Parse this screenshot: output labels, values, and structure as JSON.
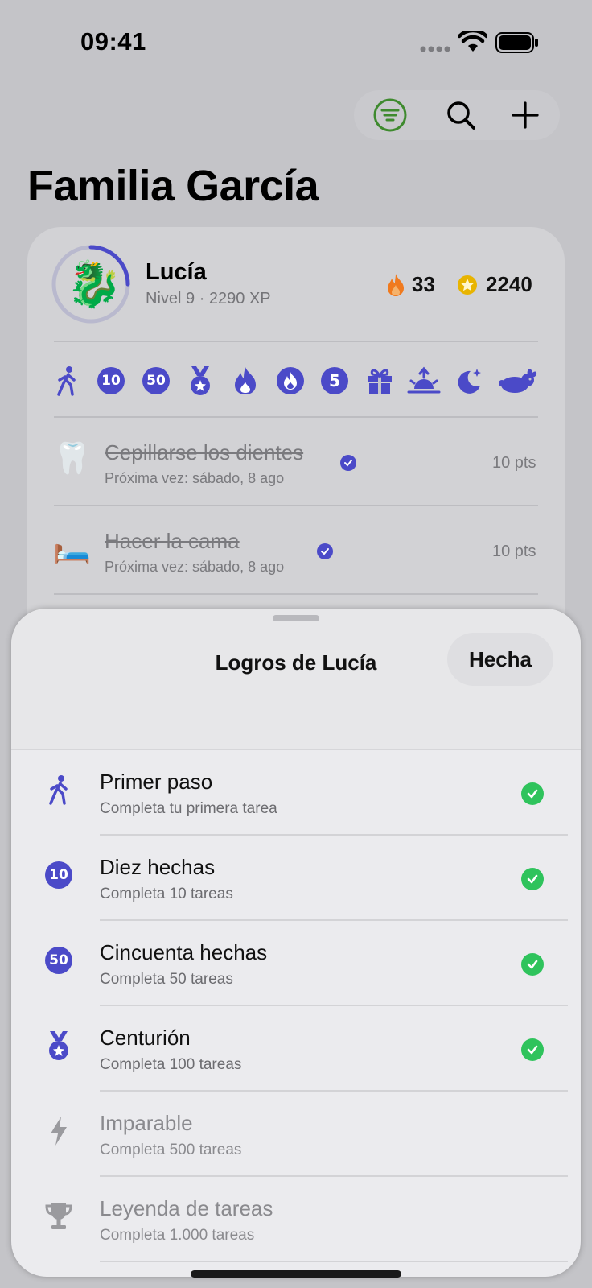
{
  "status_bar": {
    "time": "09:41"
  },
  "title": "Familia García",
  "member": {
    "name": "Lucía",
    "subtitle": "Nivel 9 · 2290 XP",
    "avatar": "🐉",
    "streak": "33",
    "coins": "2240",
    "level_progress": 0.25
  },
  "badges": [
    "walk",
    "10",
    "50",
    "medal",
    "flame",
    "flame-circle",
    "5",
    "gift",
    "sunrise",
    "moon",
    "rabbit"
  ],
  "tasks": [
    {
      "emoji": "🦷",
      "title": "Cepillarse los dientes",
      "subtitle": "Próxima vez: sábado, 8 ago",
      "points": "10 pts"
    },
    {
      "emoji": "🛏️",
      "title": "Hacer la cama",
      "subtitle": "Próxima vez: sábado, 8 ago",
      "points": "10 pts"
    }
  ],
  "sheet": {
    "title": "Logros de Lucía",
    "done_label": "Hecha",
    "achievements": [
      {
        "title": "Primer paso",
        "desc": "Completa tu primera tarea",
        "icon": "walk-icon",
        "unlocked": true
      },
      {
        "title": "Diez hechas",
        "desc": "Completa 10 tareas",
        "icon": "10",
        "unlocked": true
      },
      {
        "title": "Cincuenta hechas",
        "desc": "Completa 50 tareas",
        "icon": "50",
        "unlocked": true
      },
      {
        "title": "Centurión",
        "desc": "Completa 100 tareas",
        "icon": "medal-icon",
        "unlocked": true
      },
      {
        "title": "Imparable",
        "desc": "Completa 500 tareas",
        "icon": "bolt-icon",
        "unlocked": false
      },
      {
        "title": "Leyenda de tareas",
        "desc": "Completa 1.000 tareas",
        "icon": "trophy-icon",
        "unlocked": false
      }
    ]
  },
  "colors": {
    "accent": "#4b4ac8",
    "check": "#2fc35c",
    "filter": "#3e8a2e",
    "flame": "#f07a1e",
    "coin": "#e8b400"
  }
}
